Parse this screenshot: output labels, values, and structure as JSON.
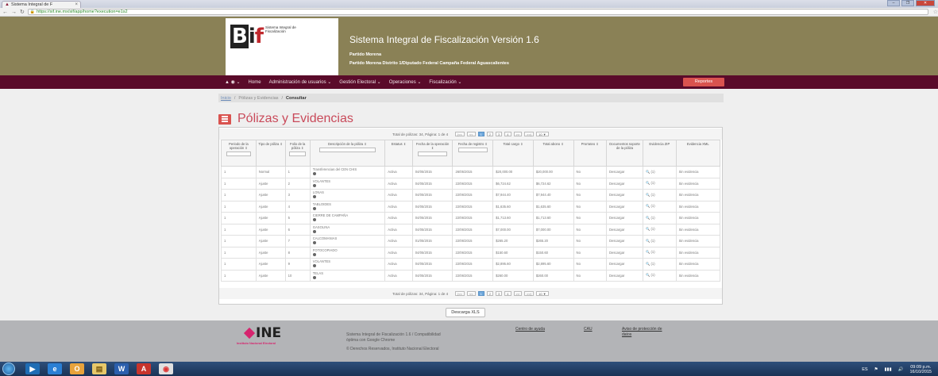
{
  "browser": {
    "tab_title": "Sistema Integral de F",
    "tab_close": "×",
    "url": "https://sif.ine.mx/sif/app/home?execution=e1s2",
    "window_controls": [
      "–",
      "❐",
      "✕"
    ]
  },
  "header": {
    "logo_text": "Sistema Integral de Fiscalización",
    "title": "Sistema Integral de Fiscalización Versión 1.6",
    "party": "Partido Morena",
    "context": "Partido Morena Distrito 1/Diputado Federal Campaña Federal Aguascalientes"
  },
  "nav": {
    "user_icon": "▲ ◉ ⌄",
    "items": [
      "Home",
      "Administración de usuarios ⌄",
      "Gestión Electoral ⌄",
      "Operaciones ⌄",
      "Fiscalización ⌄"
    ],
    "reportes": "Reportes"
  },
  "breadcrumb": {
    "home": "Inicio",
    "sep": "/",
    "section": "Pólizas y Evidencias",
    "current": "Consultar"
  },
  "page_title": "Pólizas y Evidencias",
  "pager_top": {
    "info": "Total de pólizas: 34, Página: 1 de 4",
    "first": "|<<",
    "prev": "<<",
    "pages": [
      "1",
      "2",
      "3",
      "4"
    ],
    "next": ">>",
    "last": ">>|",
    "per_page": "10 ▼"
  },
  "pager_bottom": {
    "info": "Total de pólizas: 34, Página: 1 de 4",
    "first": "|<<",
    "prev": "<<",
    "pages": [
      "1",
      "2",
      "3",
      "4"
    ],
    "next": ">>",
    "last": ">>|",
    "per_page": "10 ▼"
  },
  "table": {
    "columns": [
      "Periodo de la operación ⇕",
      "Tipo de póliza ⇕",
      "Folio de la póliza ⇕",
      "Descripción de la póliza ⇕",
      "Estatus ⇕",
      "Fecha de la operación ⇕",
      "Fecha de registro ⇕",
      "Total cargo ⇕",
      "Total abono ⇕",
      "Prorrateo ⇕",
      "Documentos soporte de la póliza",
      "Evidencia ZIP",
      "Evidencia XML"
    ],
    "rows": [
      [
        "1",
        "Normal",
        "1",
        "Transferencias del CEN CHIS",
        "Activa",
        "04/05/2015",
        "26/05/2015",
        "$20,000.00",
        "$20,000.00",
        "No",
        "Descargar",
        "🔍 (1)",
        "Sin evidencia"
      ],
      [
        "1",
        "Ajuste",
        "2",
        "VOLANTES",
        "Activa",
        "04/05/2015",
        "22/06/2015",
        "$6,724.62",
        "$6,724.62",
        "No",
        "Descargar",
        "🔍 (1)",
        "Sin evidencia"
      ],
      [
        "1",
        "Ajuste",
        "3",
        "LONAS",
        "Activa",
        "04/05/2015",
        "22/06/2015",
        "$7,944.40",
        "$7,944.40",
        "No",
        "Descargar",
        "🔍 (1)",
        "Sin evidencia"
      ],
      [
        "1",
        "Ajuste",
        "4",
        "TABLOIDES",
        "Activa",
        "04/05/2015",
        "22/06/2015",
        "$1,635.60",
        "$1,635.60",
        "No",
        "Descargar",
        "🔍 (1)",
        "Sin evidencia"
      ],
      [
        "1",
        "Ajuste",
        "5",
        "CIERRE DE CAMPAÑA",
        "Activa",
        "04/05/2015",
        "22/06/2015",
        "$1,713.60",
        "$1,713.60",
        "No",
        "Descargar",
        "🔍 (1)",
        "Sin evidencia"
      ],
      [
        "1",
        "Ajuste",
        "6",
        "GASOLINA",
        "Activa",
        "04/05/2015",
        "22/06/2015",
        "$7,000.00",
        "$7,000.00",
        "No",
        "Descargar",
        "🔍 (1)",
        "Sin evidencia"
      ],
      [
        "1",
        "Ajuste",
        "7",
        "CALCOMANIAS",
        "Activa",
        "01/05/2015",
        "22/06/2015",
        "$265.20",
        "$265.20",
        "No",
        "Descargar",
        "🔍 (1)",
        "Sin evidencia"
      ],
      [
        "1",
        "Ajuste",
        "8",
        "FOTOCOPIADO",
        "Activa",
        "04/05/2015",
        "22/06/2015",
        "$150.60",
        "$150.60",
        "No",
        "Descargar",
        "🔍 (1)",
        "Sin evidencia"
      ],
      [
        "1",
        "Ajuste",
        "9",
        "VOLANTES",
        "Activa",
        "04/05/2015",
        "22/06/2015",
        "$2,895.60",
        "$2,895.60",
        "No",
        "Descargar",
        "🔍 (1)",
        "Sin evidencia"
      ],
      [
        "1",
        "Ajuste",
        "10",
        "TELAS",
        "Activa",
        "04/05/2015",
        "22/06/2015",
        "$260.00",
        "$260.00",
        "No",
        "Descargar",
        "🔍 (1)",
        "Sin evidencia"
      ]
    ]
  },
  "download_button": "Descarga XLS",
  "footer": {
    "ine": "INE",
    "ine_sub": "Instituto Nacional Electoral",
    "line1": "Sistema Integral de Fiscalización 1.6 / Compatibilidad",
    "line2": "óptima con Google Chrome",
    "line3": "© Derechos Reservados, Instituto Nacional Electoral",
    "link_help": "Centro de ayuda",
    "link_cau": "CAU",
    "link_privacy1": "Aviso de protección de",
    "link_privacy2": "datos"
  },
  "taskbar": {
    "lang": "ES",
    "time": "09:09 p.m.",
    "date": "16/10/2015"
  }
}
